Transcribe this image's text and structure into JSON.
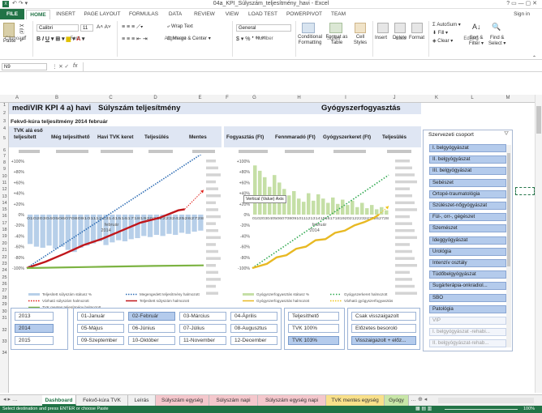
{
  "window": {
    "title": "04a_KPI_Súlyszám_teljesítmény_havi - Excel",
    "signin": "Sign in"
  },
  "ribbon_tabs": [
    "FILE",
    "HOME",
    "INSERT",
    "PAGE LAYOUT",
    "FORMULAS",
    "DATA",
    "REVIEW",
    "VIEW",
    "LOAD TEST",
    "POWERPIVOT",
    "TEAM"
  ],
  "ribbon": {
    "paste": "Paste",
    "clipboard": "Clipboard",
    "font_name": "Calibri",
    "font_size": "11",
    "font": "Font",
    "wrap_text": "Wrap Text",
    "merge_center": "Merge & Center",
    "alignment": "Alignment",
    "number_format": "General",
    "number": "Number",
    "conditional": "Conditional",
    "conditional2": "Formatting",
    "format_as": "Format as",
    "format_as2": "Table",
    "cell": "Cell",
    "cell2": "Styles",
    "styles": "Styles",
    "insert": "Insert",
    "delete": "Delete",
    "format": "Format",
    "cells": "Cells",
    "autosum": "AutoSum",
    "fill": "Fill",
    "clear": "Clear",
    "sort": "Sort &",
    "sort2": "Filter",
    "find": "Find &",
    "find2": "Select",
    "editing": "Editing"
  },
  "formula": {
    "namebox": "N9",
    "fx": "fx"
  },
  "columns": [
    "A",
    "B",
    "C",
    "D",
    "E",
    "F",
    "G",
    "H",
    "I",
    "J",
    "K",
    "L",
    "M"
  ],
  "rows": [
    "1",
    "2",
    "3",
    "4",
    "5",
    "6",
    "7",
    "8",
    "9",
    "10",
    "11",
    "12",
    "13",
    "14",
    "15",
    "16",
    "17",
    "18",
    "19",
    "20",
    "21",
    "22",
    "23",
    "24",
    "25",
    "26",
    "27",
    "28",
    "29",
    "30",
    "31",
    "32",
    "33",
    "34"
  ],
  "header": {
    "app": "mediVIR KPI 4 a) havi",
    "weight": "Súlyszám teljesítmény",
    "drug": "Gyógyszerfogyasztás",
    "subtitle": "Fekvő-kúra teljesítmény 2014 február",
    "cols": [
      "TVK alá eső teljesített",
      "Még teljesíthető",
      "Havi TVK keret",
      "Teljesülés",
      "Mentes",
      "Fogyasztás (Ft)",
      "Fennmaradó (Ft)",
      "Gyógyszerkeret (Ft)",
      "Teljesülés"
    ]
  },
  "chart_left": {
    "yticks": [
      "+100%",
      "+80%",
      "+60%",
      "+40%",
      "+20%",
      "0%",
      "-20%",
      "-40%",
      "-60%",
      "-80%",
      "-100%"
    ],
    "xticks": "01020304050607080910111213141516171819202122232425262728",
    "year_label": "2014",
    "month_label": "február",
    "legend": [
      "Teljesített súlyszám státusz %",
      "Megengedett teljesítmény halmozott",
      "Várható súlyszám halmozott",
      "Teljesített súlyszám halmozott",
      "TVK mentes teljesítmény halmozott"
    ],
    "colors": {
      "bar": "#b7cfe9",
      "allowed": "#2e6db4",
      "expected": "#e0201b",
      "actual": "#c0161b",
      "tvk": "#7cb342"
    }
  },
  "chart_right": {
    "yticks": [
      "+100%",
      "+80%",
      "+60%",
      "+40%",
      "+20%",
      "0%",
      "-20%",
      "-40%",
      "-60%",
      "-80%",
      "-100%"
    ],
    "xticks": "01020304050607080910111213141516171819202122232425262728",
    "year_label": "2014",
    "month_label": "február",
    "tooltip": "Vertical (Value) Axis",
    "legend": [
      "Gyógyszerfogyasztás státusz %",
      "Gyógyszerkeret halmozott",
      "Gyógyszerfogyasztás halmozott",
      "Várható gyógyszerfogyasztás"
    ],
    "colors": {
      "bar": "#c5dfa6",
      "budget": "#2fa84f",
      "consumption": "#e8b923",
      "expected": "#f0c419"
    }
  },
  "slicer": {
    "title": "Szervezeti csoport",
    "items": [
      "I. belgyógyászat",
      "II. belgyógyászat",
      "III. belgyógyászat",
      "Sebészet",
      "Ortopé-traumatológia",
      "Szülészet-nőgyógyászat",
      "Fül-, orr-, gégészet",
      "Szemészet",
      "Ideggyógyászat",
      "Urológia",
      "Intenzív osztály",
      "Tüdőbelgyógyászat",
      "Sugárterápia-onkradiol...",
      "SBO",
      "Patológia",
      "VIP",
      "I. belgyógyászat -rehabi...",
      "II. belgyógyászat-rehab..."
    ]
  },
  "years": [
    "2013",
    "2014",
    "2015"
  ],
  "months": [
    "01-Január",
    "02-Február",
    "03-Március",
    "04-Április",
    "05-Május",
    "06-Június",
    "07-Július",
    "08-Augusztus",
    "09-Szeptember",
    "10-Október",
    "11-November",
    "12-December"
  ],
  "tvk": [
    "Teljesíthető",
    "TVK 100%",
    "TVK 103%"
  ],
  "visits": [
    "Csak visszaigazolt",
    "Előzetes besoroló",
    "Visszaigazolt + előz..."
  ],
  "sheet_tabs": [
    "Dashboard",
    "Fekvő-kúra TVK",
    "Leírás",
    "Súlyszám egység",
    "Súlyszám napi",
    "Súlyszám egység napi",
    "TVK mentes egység",
    "Gyógy"
  ],
  "status": {
    "text": "Select destination and press ENTER or choose Paste",
    "zoom": "100%"
  }
}
